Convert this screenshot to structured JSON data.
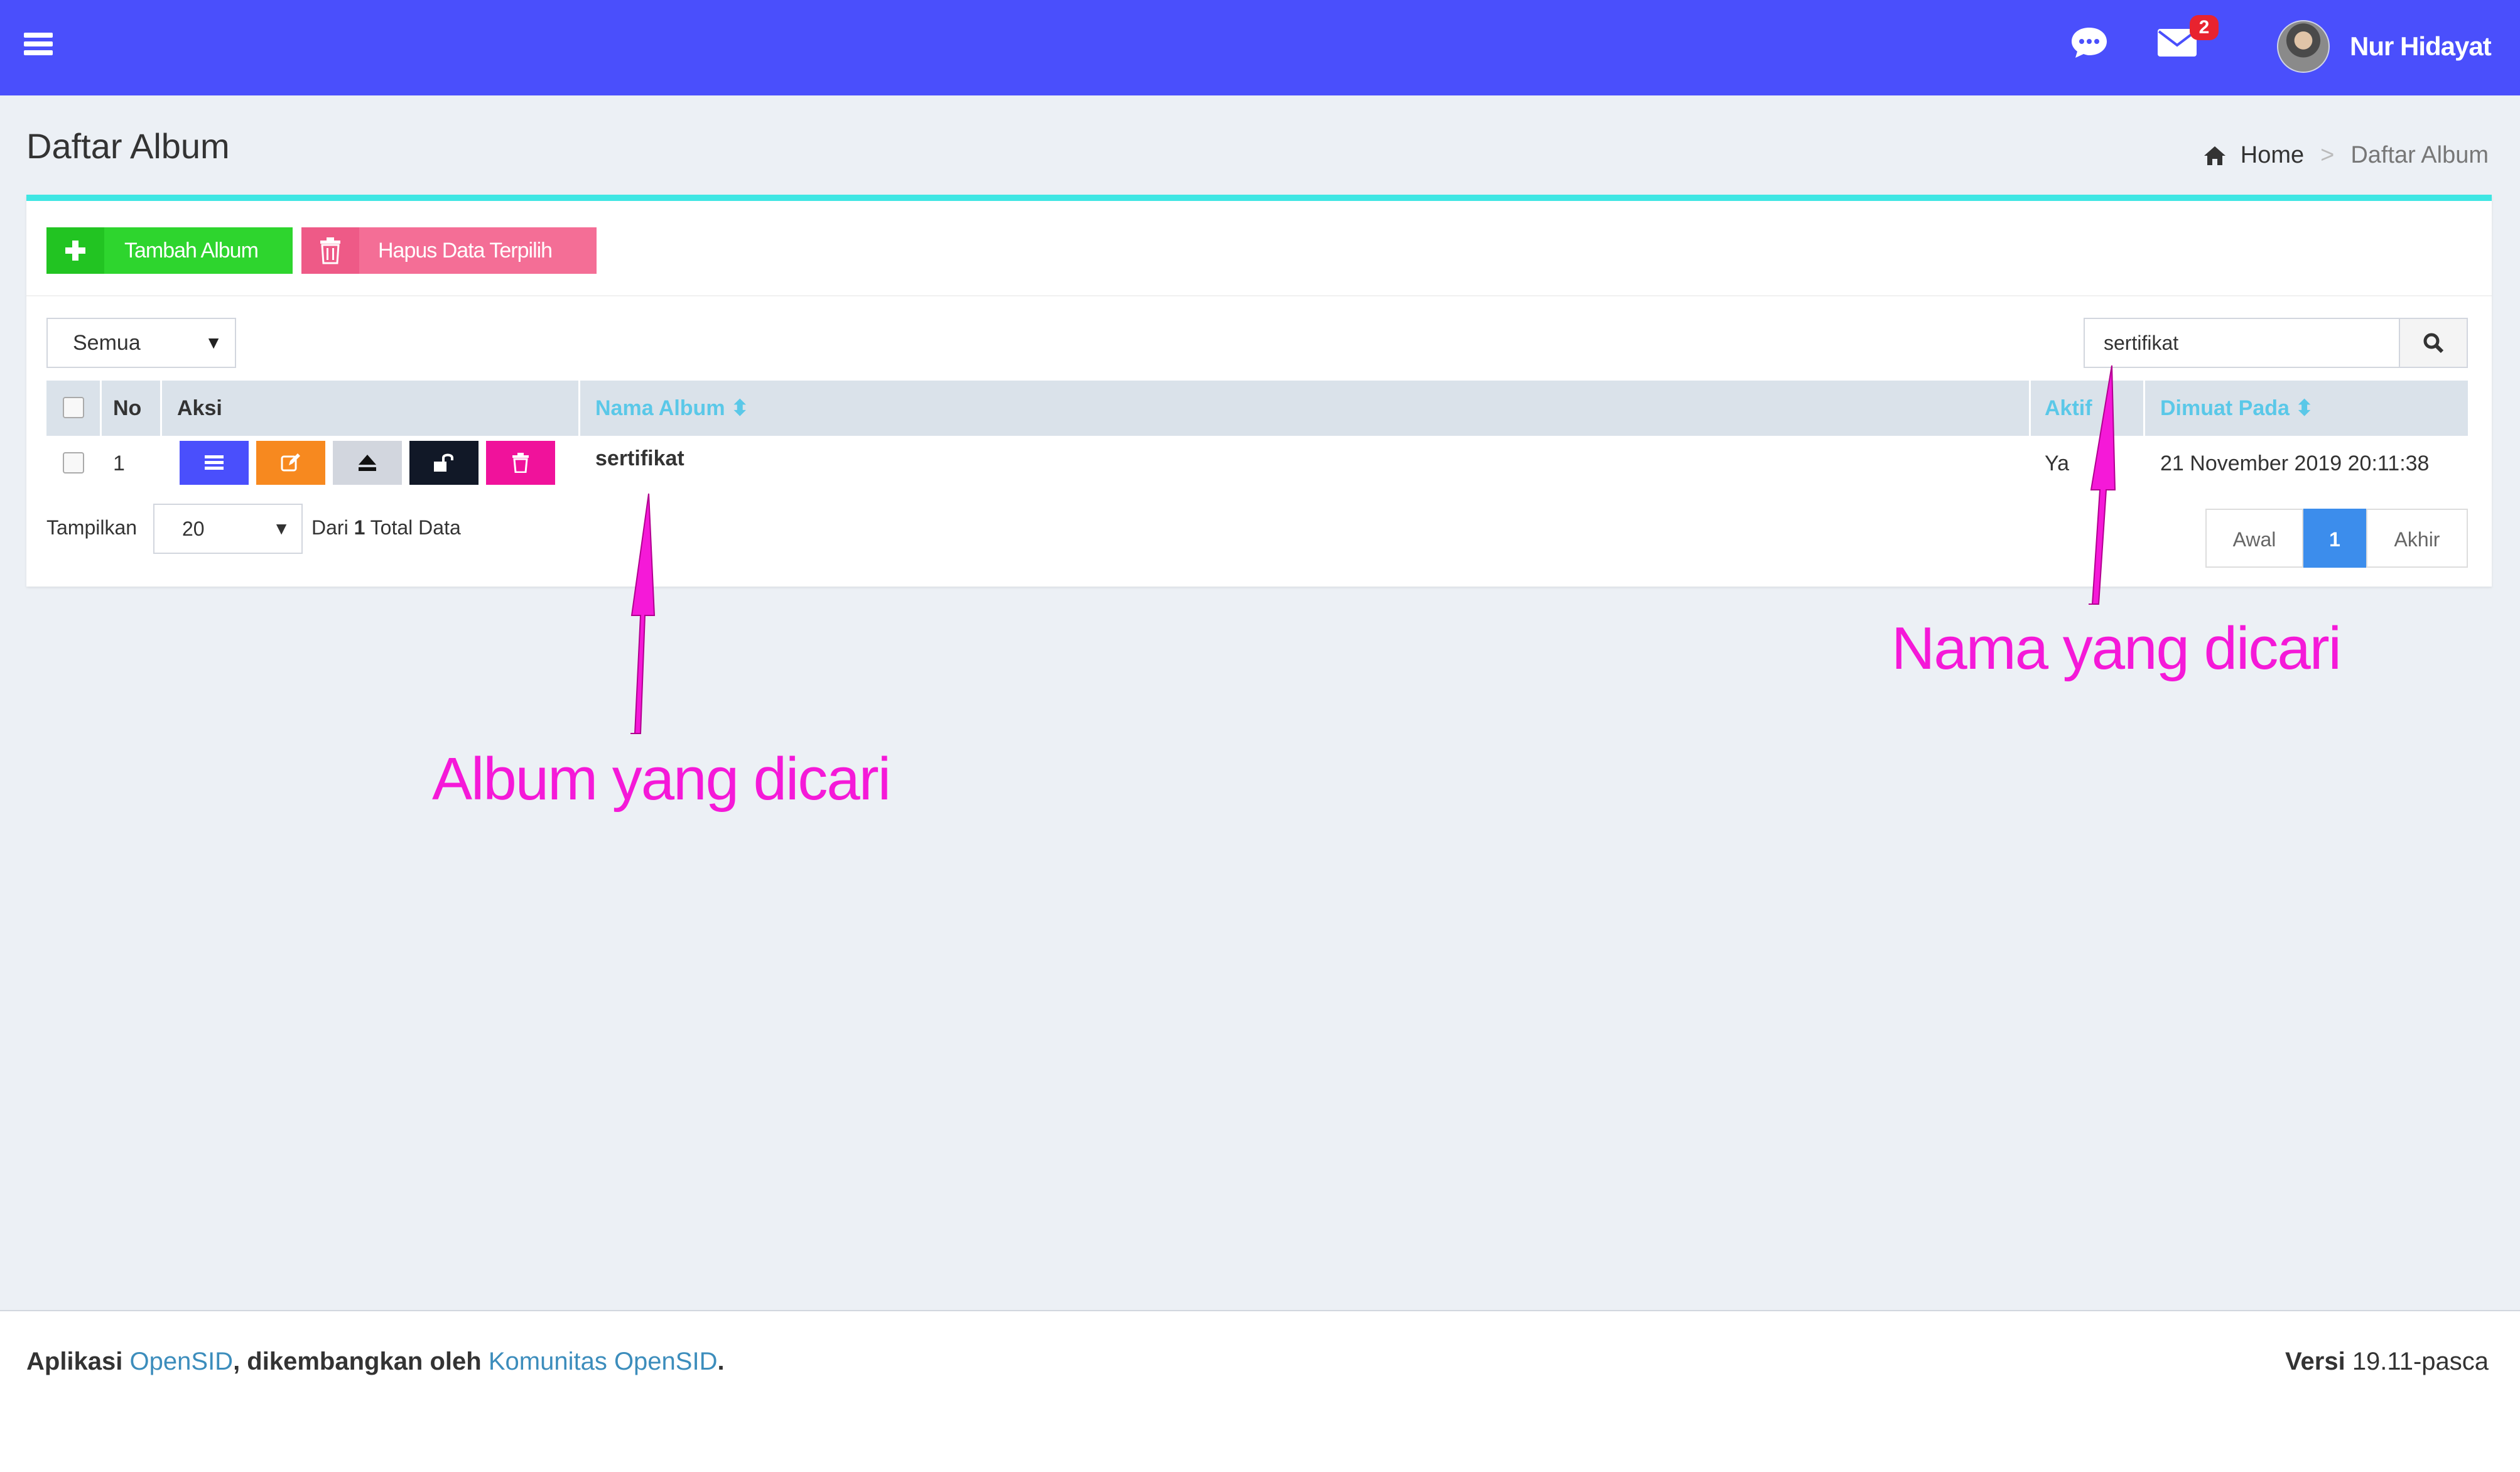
{
  "header": {
    "user_name": "Nur Hidayat",
    "mail_badge": "2",
    "icons": [
      "menu-icon",
      "chat-icon",
      "mail-icon"
    ]
  },
  "page": {
    "title": "Daftar Album",
    "breadcrumb": {
      "home": "Home",
      "separator": ">",
      "current": "Daftar Album"
    }
  },
  "toolbar": {
    "add_label": "Tambah Album",
    "delete_label": "Hapus Data Terpilih"
  },
  "filter": {
    "selected": "Semua"
  },
  "search": {
    "value": "sertifikat"
  },
  "table": {
    "columns": [
      "No",
      "Aksi",
      "Nama Album",
      "Aktif",
      "Dimuat Pada"
    ],
    "rows": [
      {
        "no": "1",
        "nama_album": "sertifikat",
        "aktif": "Ya",
        "dimuat_pada": "21 November 2019 20:11:38"
      }
    ]
  },
  "paging": {
    "show_label": "Tampilkan",
    "per_page": "20",
    "dari": "Dari",
    "total": "1",
    "total_label": "Total Data",
    "first": "Awal",
    "current": "1",
    "last": "Akhir"
  },
  "annotations": {
    "album": "Album yang dicari",
    "nama": "Nama yang dicari"
  },
  "footer": {
    "prefix": "Aplikasi",
    "app_link": "OpenSID",
    "middle": ", dikembangkan oleh",
    "community_link": "Komunitas OpenSID",
    "suffix": ".",
    "version_label": "Versi",
    "version": "19.11-pasca"
  },
  "colors": {
    "topbar": "#4a4ffc",
    "accent_line": "#3fe6e3",
    "add_button": "#2ed52e",
    "delete_button": "#f46e96",
    "annotation": "#f519d8"
  }
}
